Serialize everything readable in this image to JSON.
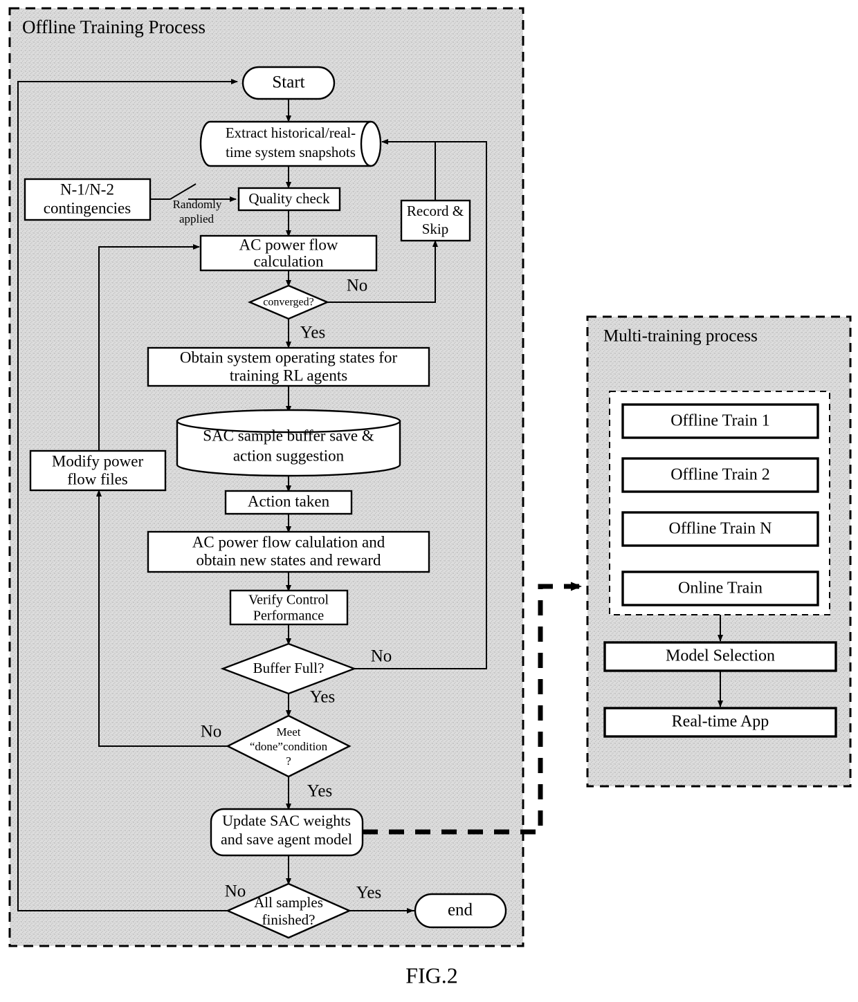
{
  "figure": {
    "caption": "FIG.2",
    "title": "Offline Training Process flowchart with Multi-training process"
  },
  "colors": {
    "panel_fill": "#d8d8d8",
    "node_fill": "#ffffff",
    "stroke": "#000000",
    "background": "#ffffff"
  },
  "panels": {
    "offline": {
      "title": "Offline Training Process"
    },
    "multi": {
      "title": "Multi-training process"
    }
  },
  "nodes": {
    "start": {
      "label": "Start",
      "shape": "terminator"
    },
    "extract": {
      "label_line1": "Extract historical/real-",
      "label_line2": "time system snapshots",
      "shape": "tape"
    },
    "contingencies": {
      "label_line1": "N-1/N-2",
      "label_line2": "contingencies",
      "shape": "rect"
    },
    "quality_check": {
      "label": "Quality check",
      "shape": "rect"
    },
    "record_skip": {
      "label_line1": "Record &",
      "label_line2": "Skip",
      "shape": "rect"
    },
    "acpf": {
      "label_line1": "AC power flow",
      "label_line2": "calculation",
      "shape": "rect"
    },
    "converged": {
      "label": "converged?",
      "shape": "diamond"
    },
    "obtain_states": {
      "label_line1": "Obtain system operating states for",
      "label_line2": "training RL agents",
      "shape": "rect"
    },
    "sac_buffer": {
      "label_line1": "SAC sample buffer save &",
      "label_line2": "action suggestion",
      "shape": "cylinder"
    },
    "action_taken": {
      "label": "Action taken",
      "shape": "rect"
    },
    "acpf_new": {
      "label_line1": "AC power flow calulation and",
      "label_line2": "obtain new states and reward",
      "shape": "rect"
    },
    "verify": {
      "label_line1": "Verify Control",
      "label_line2": "Performance",
      "shape": "rect"
    },
    "buffer_full": {
      "label": "Buffer Full?",
      "shape": "diamond"
    },
    "done_condition": {
      "label_line1": "Meet",
      "label_line2": "“done”condition",
      "label_line3": "?",
      "shape": "diamond"
    },
    "modify_power": {
      "label_line1": "Modify power",
      "label_line2": "flow files",
      "shape": "rect"
    },
    "update_sac": {
      "label_line1": "Update SAC weights",
      "label_line2": "and save agent model",
      "shape": "rounded"
    },
    "all_samples": {
      "label_line1": "All samples",
      "label_line2": "finished?",
      "shape": "diamond"
    },
    "end": {
      "label": "end",
      "shape": "terminator"
    },
    "offline_train_1": {
      "label": "Offline Train 1",
      "shape": "rect"
    },
    "offline_train_2": {
      "label": "Offline Train 2",
      "shape": "rect"
    },
    "offline_train_n": {
      "label": "Offline Train N",
      "shape": "rect"
    },
    "online_train": {
      "label": "Online Train",
      "shape": "rect"
    },
    "model_selection": {
      "label": "Model Selection",
      "shape": "rect"
    },
    "realtime_app": {
      "label": "Real-time App",
      "shape": "rect"
    }
  },
  "edge_labels": {
    "randomly_applied_1": "Randomly",
    "randomly_applied_2": "applied",
    "converged_no": "No",
    "converged_yes": "Yes",
    "buffer_no": "No",
    "buffer_yes": "Yes",
    "done_no": "No",
    "done_yes": "Yes",
    "samples_no": "No",
    "samples_yes": "Yes"
  }
}
